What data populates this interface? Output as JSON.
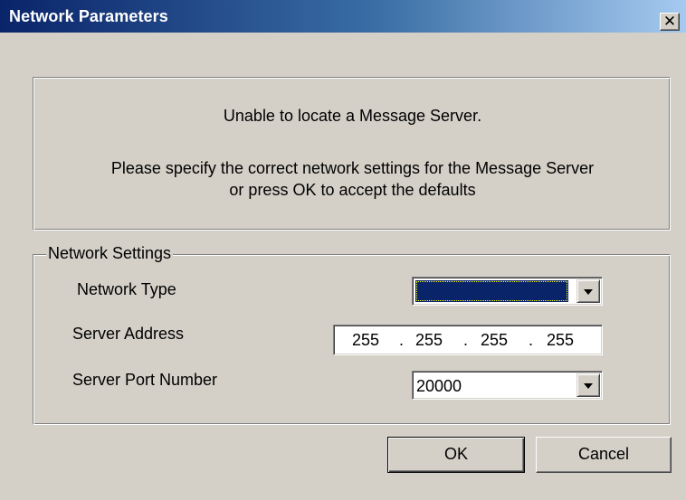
{
  "window": {
    "title": "Network Parameters",
    "close_glyph": "✕",
    "close_icon": "close-icon"
  },
  "message": {
    "line1": "Unable to locate a Message Server.",
    "line2": "Please specify the correct network settings for the Message Server",
    "line3": "or press OK to accept the defaults"
  },
  "network_settings": {
    "legend": "Network Settings",
    "network_type": {
      "label": "Network Type",
      "value": ""
    },
    "server_address": {
      "label": "Server Address",
      "octets": [
        "255",
        "255",
        "255",
        "255"
      ],
      "separator": "."
    },
    "server_port": {
      "label": "Server Port Number",
      "value": "20000"
    }
  },
  "buttons": {
    "ok": "OK",
    "cancel": "Cancel"
  },
  "colors": {
    "title_start": "#0a246a",
    "title_end": "#a6caf0",
    "face": "#d4d0c8",
    "selection": "#0a246a"
  }
}
